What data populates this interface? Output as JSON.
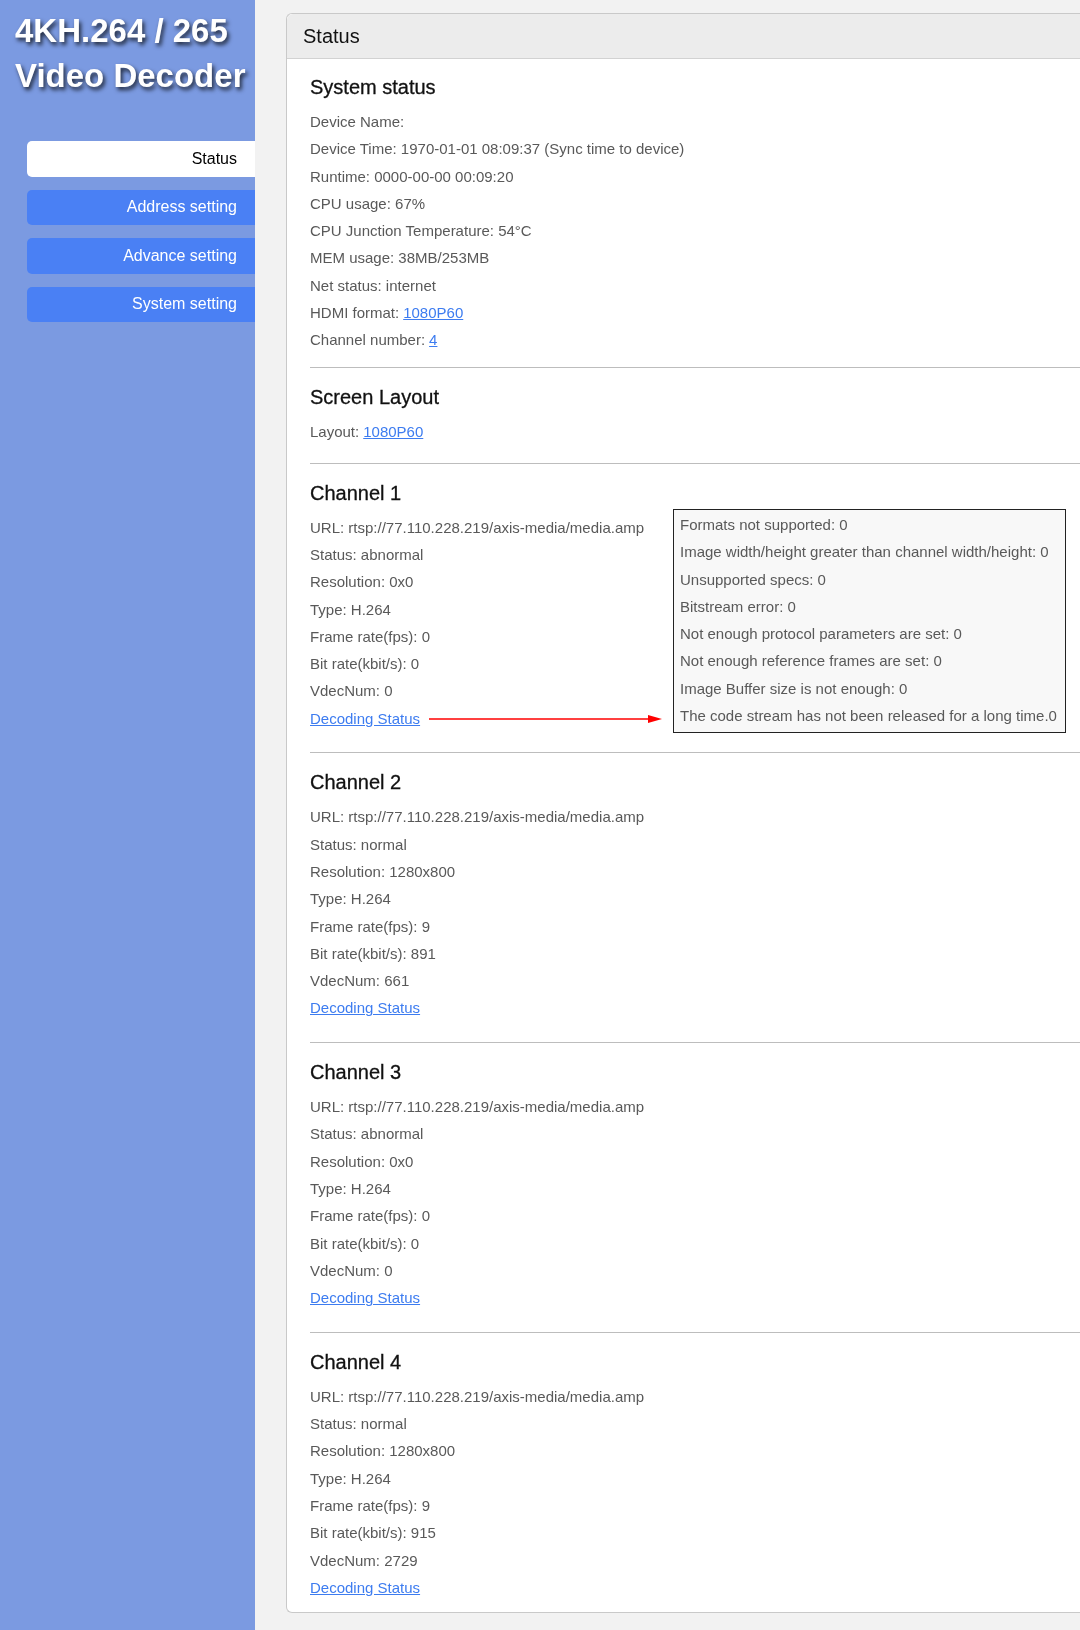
{
  "logo": {
    "lines": [
      "4KH.264 / 265",
      "Video Decoder"
    ]
  },
  "sidebar": {
    "items": [
      {
        "label": "Status",
        "selected": true
      },
      {
        "label": "Address setting",
        "selected": false
      },
      {
        "label": "Advance setting",
        "selected": false
      },
      {
        "label": "System setting",
        "selected": false
      }
    ]
  },
  "panel": {
    "title": "Status",
    "system_status": {
      "title": "System status",
      "lines": [
        {
          "text": "Device Name:"
        },
        {
          "text": "Device Time: 1970-01-01 08:09:37 (Sync time to device)"
        },
        {
          "text": "Runtime: 0000-00-00 00:09:20"
        },
        {
          "text": "CPU usage: 67%"
        },
        {
          "text": "CPU Junction Temperature: 54°C"
        },
        {
          "text": "MEM usage: 38MB/253MB"
        },
        {
          "text": "Net status: internet"
        },
        {
          "text": "HDMI format:",
          "link": "1080P60"
        },
        {
          "text": "Channel number:",
          "link": "4"
        }
      ]
    },
    "screen_layout": {
      "title": "Screen Layout",
      "lines": [
        {
          "text": "Layout:",
          "link": "1080P60"
        }
      ]
    },
    "channels": [
      {
        "title": "Channel 1",
        "lines": [
          {
            "text": "URL: rtsp://77.110.228.219/axis-media/media.amp"
          },
          {
            "text": "Status: abnormal"
          },
          {
            "text": "Resolution: 0x0"
          },
          {
            "text": "Type: H.264"
          },
          {
            "text": "Frame rate(fps): 0"
          },
          {
            "text": "Bit rate(kbit/s): 0"
          },
          {
            "text": "VdecNum: 0"
          }
        ],
        "decoding_status": {
          "label": "Decoding Status",
          "details": [
            "Formats not supported: 0",
            "Image width/height greater than channel width/height: 0",
            "Unsupported specs: 0",
            "Bitstream error: 0",
            "Not enough protocol parameters are set: 0",
            "Not enough reference frames are set: 0",
            "Image Buffer size is not enough: 0",
            "The code stream has not been released for a long time.0"
          ]
        }
      },
      {
        "title": "Channel 2",
        "lines": [
          {
            "text": "URL: rtsp://77.110.228.219/axis-media/media.amp"
          },
          {
            "text": "Status: normal"
          },
          {
            "text": "Resolution: 1280x800"
          },
          {
            "text": "Type: H.264"
          },
          {
            "text": "Frame rate(fps): 9"
          },
          {
            "text": "Bit rate(kbit/s): 891"
          },
          {
            "text": "VdecNum: 661"
          }
        ],
        "decoding_status": {
          "label": "Decoding Status"
        }
      },
      {
        "title": "Channel 3",
        "lines": [
          {
            "text": "URL: rtsp://77.110.228.219/axis-media/media.amp"
          },
          {
            "text": "Status: abnormal"
          },
          {
            "text": "Resolution: 0x0"
          },
          {
            "text": "Type: H.264"
          },
          {
            "text": "Frame rate(fps): 0"
          },
          {
            "text": "Bit rate(kbit/s): 0"
          },
          {
            "text": "VdecNum: 0"
          }
        ],
        "decoding_status": {
          "label": "Decoding Status"
        }
      },
      {
        "title": "Channel 4",
        "lines": [
          {
            "text": "URL: rtsp://77.110.228.219/axis-media/media.amp"
          },
          {
            "text": "Status: normal"
          },
          {
            "text": "Resolution: 1280x800"
          },
          {
            "text": "Type: H.264"
          },
          {
            "text": "Frame rate(fps): 9"
          },
          {
            "text": "Bit rate(kbit/s): 915"
          },
          {
            "text": "VdecNum: 2729"
          }
        ],
        "decoding_status": {
          "label": "Decoding Status"
        }
      }
    ]
  }
}
